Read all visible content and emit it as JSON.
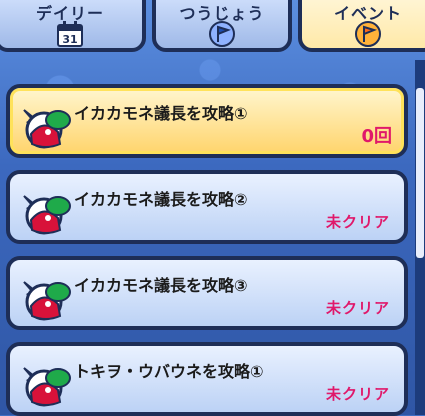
{
  "tabs": [
    {
      "label": "デイリー",
      "icon": "calendar-icon",
      "calendar_number": "31",
      "active": false
    },
    {
      "label": "つうじょう",
      "icon": "flag-icon",
      "active": false
    },
    {
      "label": "イベント",
      "icon": "event-flag-icon",
      "active": true
    }
  ],
  "quests": [
    {
      "title": "イカカモネ議長を攻略①",
      "status": "0回",
      "selected": true
    },
    {
      "title": "イカカモネ議長を攻略②",
      "status": "未クリア",
      "selected": false
    },
    {
      "title": "イカカモネ議長を攻略③",
      "status": "未クリア",
      "selected": false
    },
    {
      "title": "トキヲ・ウバウネを攻略①",
      "status": "未クリア",
      "selected": false
    }
  ],
  "colors": {
    "status_pink": "#e0186a",
    "outline_navy": "#1e2e57",
    "selected_yellow": "#ffd46b"
  }
}
